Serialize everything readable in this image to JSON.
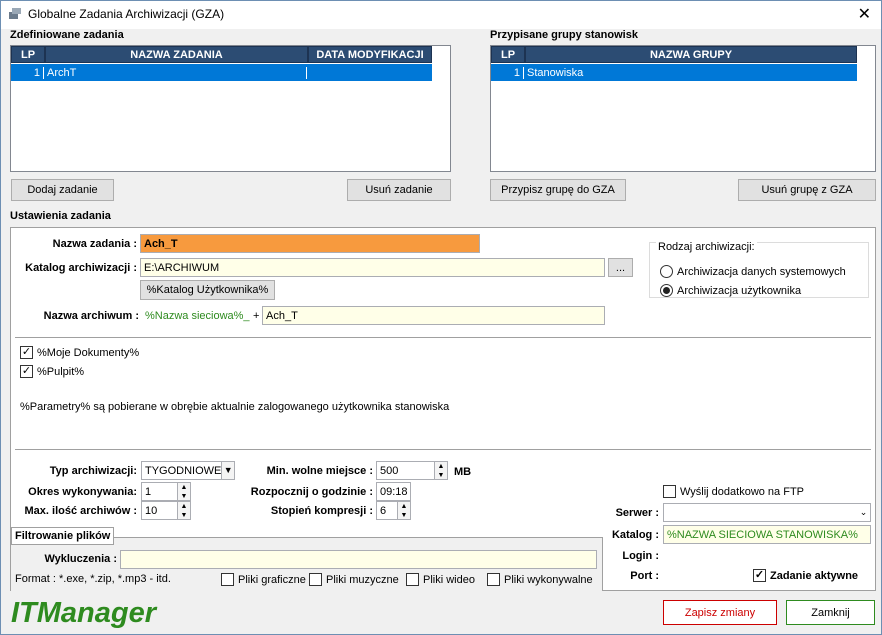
{
  "window": {
    "title": "Globalne Zadania Archiwizacji (GZA)",
    "close": "✕"
  },
  "tasks": {
    "heading": "Zdefiniowane zadania",
    "columns": [
      "LP",
      "NAZWA ZADANIA",
      "DATA MODYFIKACJI"
    ],
    "rows": [
      {
        "lp": "1",
        "name": "ArchT",
        "date": ""
      }
    ],
    "add_button": "Dodaj zadanie",
    "remove_button": "Usuń zadanie"
  },
  "groups": {
    "heading": "Przypisane grupy stanowisk",
    "columns": [
      "LP",
      "NAZWA GRUPY"
    ],
    "rows": [
      {
        "lp": "1",
        "name": "Stanowiska"
      }
    ],
    "assign_button": "Przypisz grupę do GZA",
    "remove_button": "Usuń grupę z GZA"
  },
  "settings": {
    "heading": "Ustawienia zadania",
    "task_name_label": "Nazwa zadania :",
    "task_name": "Ach_T",
    "catalog_label": "Katalog archiwizacji :",
    "catalog": "E:\\ARCHIWUM",
    "browse": "...",
    "user_catalog_button": "%Katalog Użytkownika%",
    "archive_name_label": "Nazwa archiwum :",
    "archive_prefix": "%Nazwa sieciowa%_",
    "plus": "+",
    "archive_name": "Ach_T",
    "mode_group": "Rodzaj archiwizacji:",
    "mode_system": "Archiwizacja danych systemowych",
    "mode_user": "Archiwizacja użytkownika",
    "check_documents": "%Moje Dokumenty%",
    "check_desktop": "%Pulpit%",
    "info": "%Parametry% są pobierane w obrębie aktualnie zalogowanego użytkownika stanowiska",
    "type_label": "Typ archiwizacji:",
    "type_value": "TYGODNIOWE",
    "period_label": "Okres wykonywania:",
    "period_value": "1",
    "max_label": "Max. ilość archiwów :",
    "max_value": "10",
    "free_label": "Min. wolne miejsce :",
    "free_value": "500",
    "free_unit": "MB",
    "start_label": "Rozpocznij o godzinie :",
    "start_value": "09:18",
    "compression_label": "Stopień kompresji :",
    "compression_value": "6"
  },
  "filter": {
    "title": "Filtrowanie plików",
    "exclusions_label": "Wykluczenia :",
    "format_hint": "Format : *.exe, *.zip, *.mp3 - itd.",
    "graphics": "Pliki graficzne",
    "music": "Pliki muzyczne",
    "video": "Pliki wideo",
    "executables": "Pliki wykonywalne"
  },
  "ftp": {
    "send_label": "Wyślij dodatkowo na FTP",
    "server_label": "Serwer :",
    "catalog_label": "Katalog :",
    "catalog_value": "%NAZWA SIECIOWA STANOWISKA%",
    "login_label": "Login :",
    "port_label": "Port :",
    "active_label": "Zadanie aktywne"
  },
  "footer": {
    "brand": "ITManager",
    "save_button": "Zapisz zmiany",
    "close_button": "Zamknij"
  },
  "colors": {
    "selection": "#0078d7",
    "task_name_bg": "#f79a3e",
    "brand": "#2e8b1f",
    "save_text": "#cc0000"
  }
}
